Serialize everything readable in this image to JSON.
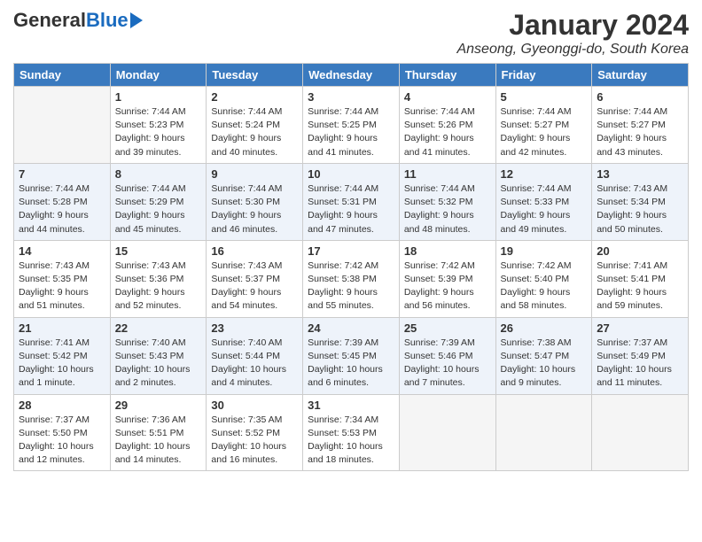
{
  "header": {
    "logo_general": "General",
    "logo_blue": "Blue",
    "month_year": "January 2024",
    "location": "Anseong, Gyeonggi-do, South Korea"
  },
  "weekdays": [
    "Sunday",
    "Monday",
    "Tuesday",
    "Wednesday",
    "Thursday",
    "Friday",
    "Saturday"
  ],
  "weeks": [
    [
      {
        "day": "",
        "info": ""
      },
      {
        "day": "1",
        "info": "Sunrise: 7:44 AM\nSunset: 5:23 PM\nDaylight: 9 hours\nand 39 minutes."
      },
      {
        "day": "2",
        "info": "Sunrise: 7:44 AM\nSunset: 5:24 PM\nDaylight: 9 hours\nand 40 minutes."
      },
      {
        "day": "3",
        "info": "Sunrise: 7:44 AM\nSunset: 5:25 PM\nDaylight: 9 hours\nand 41 minutes."
      },
      {
        "day": "4",
        "info": "Sunrise: 7:44 AM\nSunset: 5:26 PM\nDaylight: 9 hours\nand 41 minutes."
      },
      {
        "day": "5",
        "info": "Sunrise: 7:44 AM\nSunset: 5:27 PM\nDaylight: 9 hours\nand 42 minutes."
      },
      {
        "day": "6",
        "info": "Sunrise: 7:44 AM\nSunset: 5:27 PM\nDaylight: 9 hours\nand 43 minutes."
      }
    ],
    [
      {
        "day": "7",
        "info": "Sunrise: 7:44 AM\nSunset: 5:28 PM\nDaylight: 9 hours\nand 44 minutes."
      },
      {
        "day": "8",
        "info": "Sunrise: 7:44 AM\nSunset: 5:29 PM\nDaylight: 9 hours\nand 45 minutes."
      },
      {
        "day": "9",
        "info": "Sunrise: 7:44 AM\nSunset: 5:30 PM\nDaylight: 9 hours\nand 46 minutes."
      },
      {
        "day": "10",
        "info": "Sunrise: 7:44 AM\nSunset: 5:31 PM\nDaylight: 9 hours\nand 47 minutes."
      },
      {
        "day": "11",
        "info": "Sunrise: 7:44 AM\nSunset: 5:32 PM\nDaylight: 9 hours\nand 48 minutes."
      },
      {
        "day": "12",
        "info": "Sunrise: 7:44 AM\nSunset: 5:33 PM\nDaylight: 9 hours\nand 49 minutes."
      },
      {
        "day": "13",
        "info": "Sunrise: 7:43 AM\nSunset: 5:34 PM\nDaylight: 9 hours\nand 50 minutes."
      }
    ],
    [
      {
        "day": "14",
        "info": "Sunrise: 7:43 AM\nSunset: 5:35 PM\nDaylight: 9 hours\nand 51 minutes."
      },
      {
        "day": "15",
        "info": "Sunrise: 7:43 AM\nSunset: 5:36 PM\nDaylight: 9 hours\nand 52 minutes."
      },
      {
        "day": "16",
        "info": "Sunrise: 7:43 AM\nSunset: 5:37 PM\nDaylight: 9 hours\nand 54 minutes."
      },
      {
        "day": "17",
        "info": "Sunrise: 7:42 AM\nSunset: 5:38 PM\nDaylight: 9 hours\nand 55 minutes."
      },
      {
        "day": "18",
        "info": "Sunrise: 7:42 AM\nSunset: 5:39 PM\nDaylight: 9 hours\nand 56 minutes."
      },
      {
        "day": "19",
        "info": "Sunrise: 7:42 AM\nSunset: 5:40 PM\nDaylight: 9 hours\nand 58 minutes."
      },
      {
        "day": "20",
        "info": "Sunrise: 7:41 AM\nSunset: 5:41 PM\nDaylight: 9 hours\nand 59 minutes."
      }
    ],
    [
      {
        "day": "21",
        "info": "Sunrise: 7:41 AM\nSunset: 5:42 PM\nDaylight: 10 hours\nand 1 minute."
      },
      {
        "day": "22",
        "info": "Sunrise: 7:40 AM\nSunset: 5:43 PM\nDaylight: 10 hours\nand 2 minutes."
      },
      {
        "day": "23",
        "info": "Sunrise: 7:40 AM\nSunset: 5:44 PM\nDaylight: 10 hours\nand 4 minutes."
      },
      {
        "day": "24",
        "info": "Sunrise: 7:39 AM\nSunset: 5:45 PM\nDaylight: 10 hours\nand 6 minutes."
      },
      {
        "day": "25",
        "info": "Sunrise: 7:39 AM\nSunset: 5:46 PM\nDaylight: 10 hours\nand 7 minutes."
      },
      {
        "day": "26",
        "info": "Sunrise: 7:38 AM\nSunset: 5:47 PM\nDaylight: 10 hours\nand 9 minutes."
      },
      {
        "day": "27",
        "info": "Sunrise: 7:37 AM\nSunset: 5:49 PM\nDaylight: 10 hours\nand 11 minutes."
      }
    ],
    [
      {
        "day": "28",
        "info": "Sunrise: 7:37 AM\nSunset: 5:50 PM\nDaylight: 10 hours\nand 12 minutes."
      },
      {
        "day": "29",
        "info": "Sunrise: 7:36 AM\nSunset: 5:51 PM\nDaylight: 10 hours\nand 14 minutes."
      },
      {
        "day": "30",
        "info": "Sunrise: 7:35 AM\nSunset: 5:52 PM\nDaylight: 10 hours\nand 16 minutes."
      },
      {
        "day": "31",
        "info": "Sunrise: 7:34 AM\nSunset: 5:53 PM\nDaylight: 10 hours\nand 18 minutes."
      },
      {
        "day": "",
        "info": ""
      },
      {
        "day": "",
        "info": ""
      },
      {
        "day": "",
        "info": ""
      }
    ]
  ]
}
